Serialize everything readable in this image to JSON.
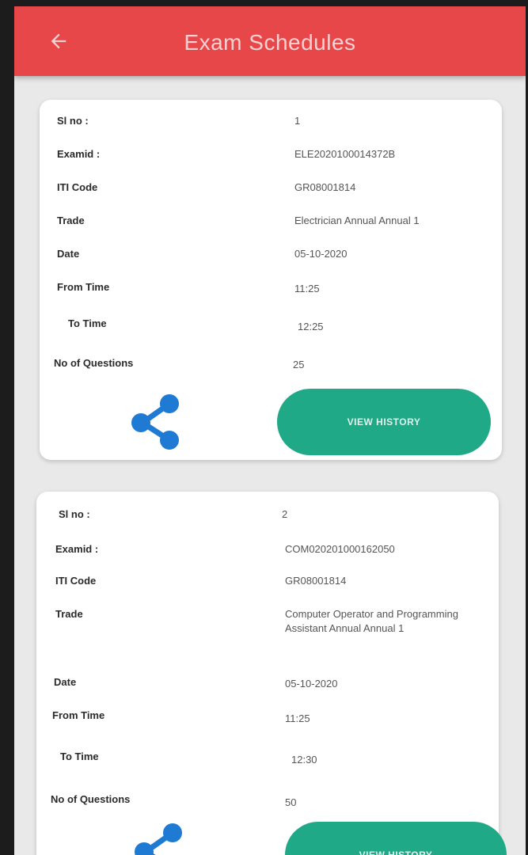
{
  "appbar": {
    "title": "Exam Schedules",
    "back_icon": "back-arrow-icon",
    "color": "#e8474a"
  },
  "labels": {
    "sl_no": "Sl no :",
    "exam_id": "Examid :",
    "iti_code": "ITI Code",
    "trade": "Trade",
    "date": "Date",
    "from_time": "From Time",
    "to_time": "To Time",
    "no_of_questions": "No of Questions"
  },
  "schedules": [
    {
      "sl_no": "1",
      "exam_id": "ELE2020100014372B",
      "iti_code": "GR08001814",
      "trade": "Electrician Annual Annual 1",
      "date": "05-10-2020",
      "from_time": "11:25",
      "to_time": "12:25",
      "no_of_questions": "25",
      "button_label": "VIEW HISTORY"
    },
    {
      "sl_no": "2",
      "exam_id": "COM020201000162050",
      "iti_code": "GR08001814",
      "trade": "Computer Operator and Programming Assistant Annual Annual 1",
      "date": "05-10-2020",
      "from_time": "11:25",
      "to_time": "12:30",
      "no_of_questions": "50",
      "button_label": "VIEW HISTORY"
    }
  ],
  "colors": {
    "accent_button": "#1fa987",
    "share_icon": "#1e7ad2"
  },
  "icons": {
    "share": "share-icon"
  }
}
